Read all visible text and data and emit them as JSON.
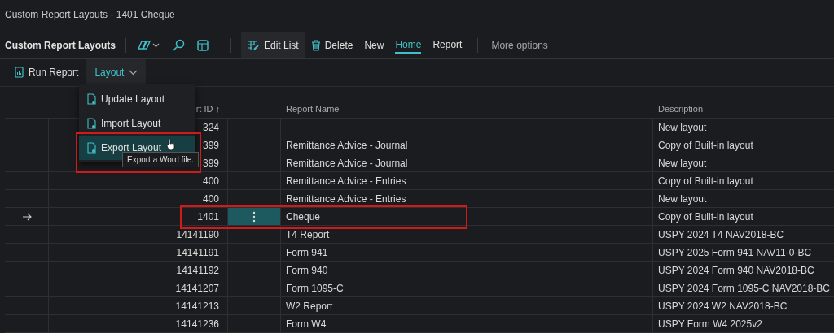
{
  "window": {
    "title": "Custom Report Layouts - 1401 Cheque"
  },
  "page_title": "Custom Report Layouts",
  "toolbar": [
    {
      "label": "Edit List",
      "kind": "edit"
    },
    {
      "label": "Delete",
      "kind": "delete"
    },
    {
      "label": "New",
      "kind": "plain"
    },
    {
      "label": "Home",
      "kind": "tab",
      "selected": true
    },
    {
      "label": "Report",
      "kind": "tab",
      "selected": false
    }
  ],
  "more_options": "More options",
  "actions": [
    {
      "label": "Run Report",
      "kind": "run",
      "expanded": false
    },
    {
      "label": "Layout",
      "kind": "menu",
      "expanded": true
    }
  ],
  "menu": {
    "items": [
      {
        "label": "Update Layout",
        "selected": false
      },
      {
        "label": "Import Layout",
        "selected": false
      },
      {
        "label": "Export Layout",
        "selected": true
      }
    ],
    "tooltip": "Export a Word file."
  },
  "table": {
    "columns": [
      "rt ID ↑",
      "Report Name",
      "Description"
    ],
    "rows": [
      {
        "id": "324",
        "name": "",
        "description": "New layout",
        "selected": false
      },
      {
        "id": "399",
        "name": "Remittance Advice - Journal",
        "description": "Copy of Built-in layout",
        "selected": false
      },
      {
        "id": "399",
        "name": "Remittance Advice - Journal",
        "description": "New layout",
        "selected": false
      },
      {
        "id": "400",
        "name": "Remittance Advice - Entries",
        "description": "Copy of Built-in layout",
        "selected": false
      },
      {
        "id": "400",
        "name": "Remittance Advice - Entries",
        "description": "New layout",
        "selected": false
      },
      {
        "id": "1401",
        "name": "Cheque",
        "description": "Copy of Built-in layout",
        "selected": true
      },
      {
        "id": "14141190",
        "name": "T4 Report",
        "description": "USPY 2024 T4 NAV2018-BC",
        "selected": false
      },
      {
        "id": "14141191",
        "name": "Form 941",
        "description": "USPY 2025 Form 941 NAV11-0-BC",
        "selected": false
      },
      {
        "id": "14141192",
        "name": "Form 940",
        "description": "USPY 2024 Form 940 NAV2018-BC",
        "selected": false
      },
      {
        "id": "14141207",
        "name": "Form 1095-C",
        "description": "USPY 2024 Form 1095-C NAV2018-BC",
        "selected": false
      },
      {
        "id": "14141213",
        "name": "W2 Report",
        "description": "USPY 2024 W2 NAV2018-BC",
        "selected": false
      },
      {
        "id": "14141236",
        "name": "Form W4",
        "description": "USPY Form W4 2025v2",
        "selected": false
      }
    ]
  }
}
